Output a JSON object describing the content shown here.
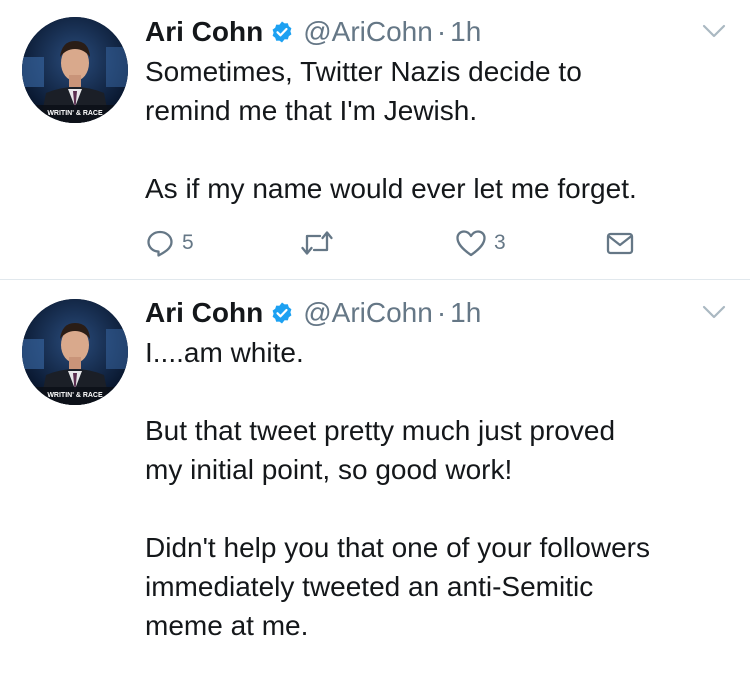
{
  "tweets": [
    {
      "author_name": "Ari Cohn",
      "handle": "@AriCohn",
      "separator": "·",
      "time": "1h",
      "text": "Sometimes, Twitter Nazis decide to\nremind me that I'm Jewish.\n\nAs if my name would ever let me forget.",
      "reply_count": "5",
      "like_count": "3",
      "avatar_caption": "WRITIN' & RACE"
    },
    {
      "author_name": "Ari Cohn",
      "handle": "@AriCohn",
      "separator": "·",
      "time": "1h",
      "text": "I....am white.\n\nBut that tweet pretty much just proved\nmy initial point, so good work!\n\nDidn't help you that one of your followers\nimmediately tweeted an anti-Semitic\nmeme at me.",
      "avatar_caption": "WRITIN' & RACE"
    }
  ],
  "colors": {
    "text": "#14171a",
    "secondary": "#657786",
    "verified_blue": "#1da1f2",
    "divider": "#e1e8ed"
  },
  "icons": {
    "verified": "verified-badge-icon",
    "caret": "chevron-down-icon",
    "reply": "reply-icon",
    "retweet": "retweet-icon",
    "like": "heart-icon",
    "dm": "envelope-icon"
  }
}
